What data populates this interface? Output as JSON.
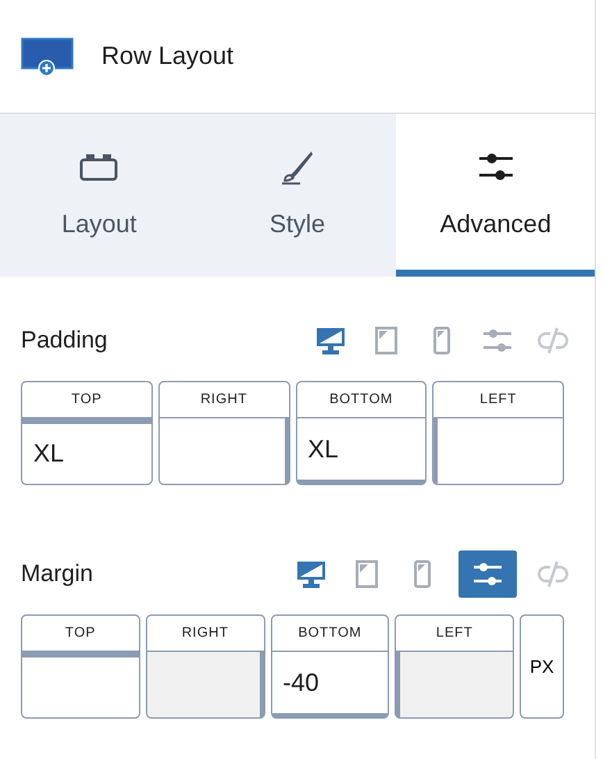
{
  "header": {
    "title": "Row Layout"
  },
  "tabs": [
    {
      "label": "Layout",
      "selected": false
    },
    {
      "label": "Style",
      "selected": false
    },
    {
      "label": "Advanced",
      "selected": true
    }
  ],
  "sections": [
    {
      "title": "Padding",
      "devices": [
        {
          "selected": true
        },
        {
          "selected": false
        },
        {
          "selected": false
        }
      ],
      "custom": false,
      "fields": [
        {
          "label": "TOP",
          "value": "XL",
          "disabled": false
        },
        {
          "label": "RIGHT",
          "disabled": false
        },
        {
          "label": "BOTTOM",
          "value": "XL",
          "disabled": false
        },
        {
          "label": "LEFT",
          "disabled": false
        }
      ]
    },
    {
      "title": "Margin",
      "devices": [
        {
          "selected": true
        },
        {
          "selected": false
        },
        {
          "selected": false
        }
      ],
      "custom": true,
      "fields": [
        {
          "label": "TOP",
          "disabled": false
        },
        {
          "label": "RIGHT",
          "disabled": true
        },
        {
          "label": "BOTTOM",
          "value": "-40",
          "disabled": false
        },
        {
          "label": "LEFT",
          "disabled": true
        }
      ],
      "unit": "PX"
    }
  ]
}
